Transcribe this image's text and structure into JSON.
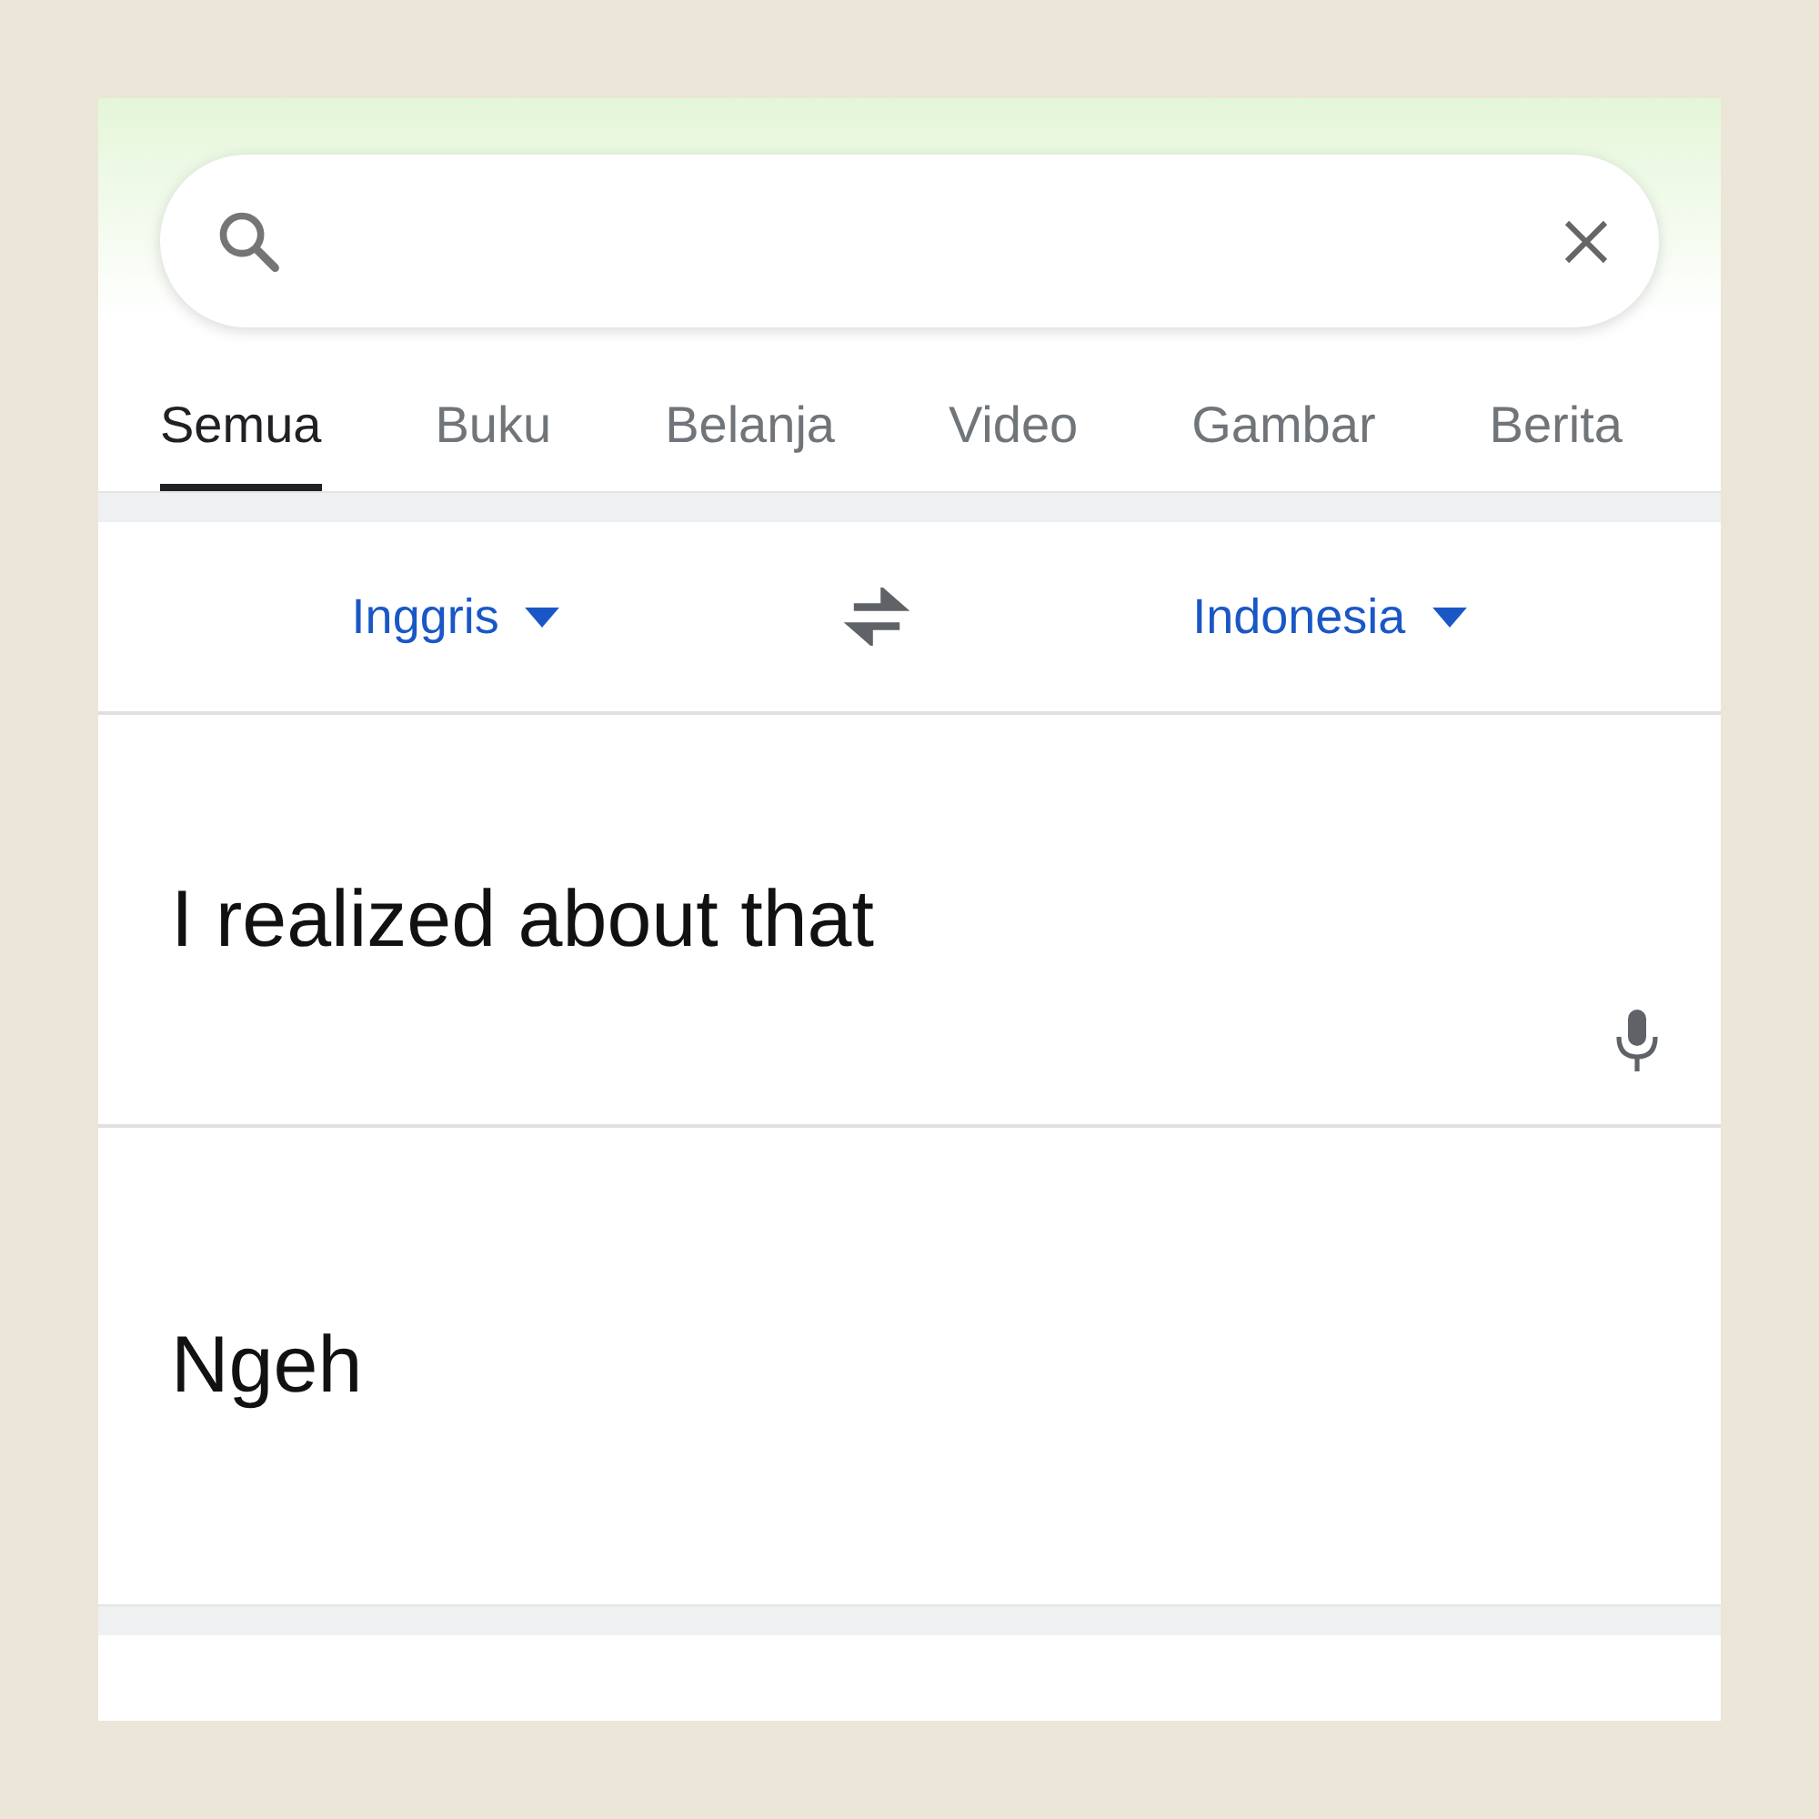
{
  "tabs": [
    {
      "label": "Semua",
      "selected": true
    },
    {
      "label": "Buku",
      "selected": false
    },
    {
      "label": "Belanja",
      "selected": false
    },
    {
      "label": "Video",
      "selected": false
    },
    {
      "label": "Gambar",
      "selected": false
    },
    {
      "label": "Berita",
      "selected": false
    }
  ],
  "translator": {
    "source_language": "Inggris",
    "target_language": "Indonesia",
    "input_text": "I realized about that",
    "output_text": "Ngeh"
  }
}
